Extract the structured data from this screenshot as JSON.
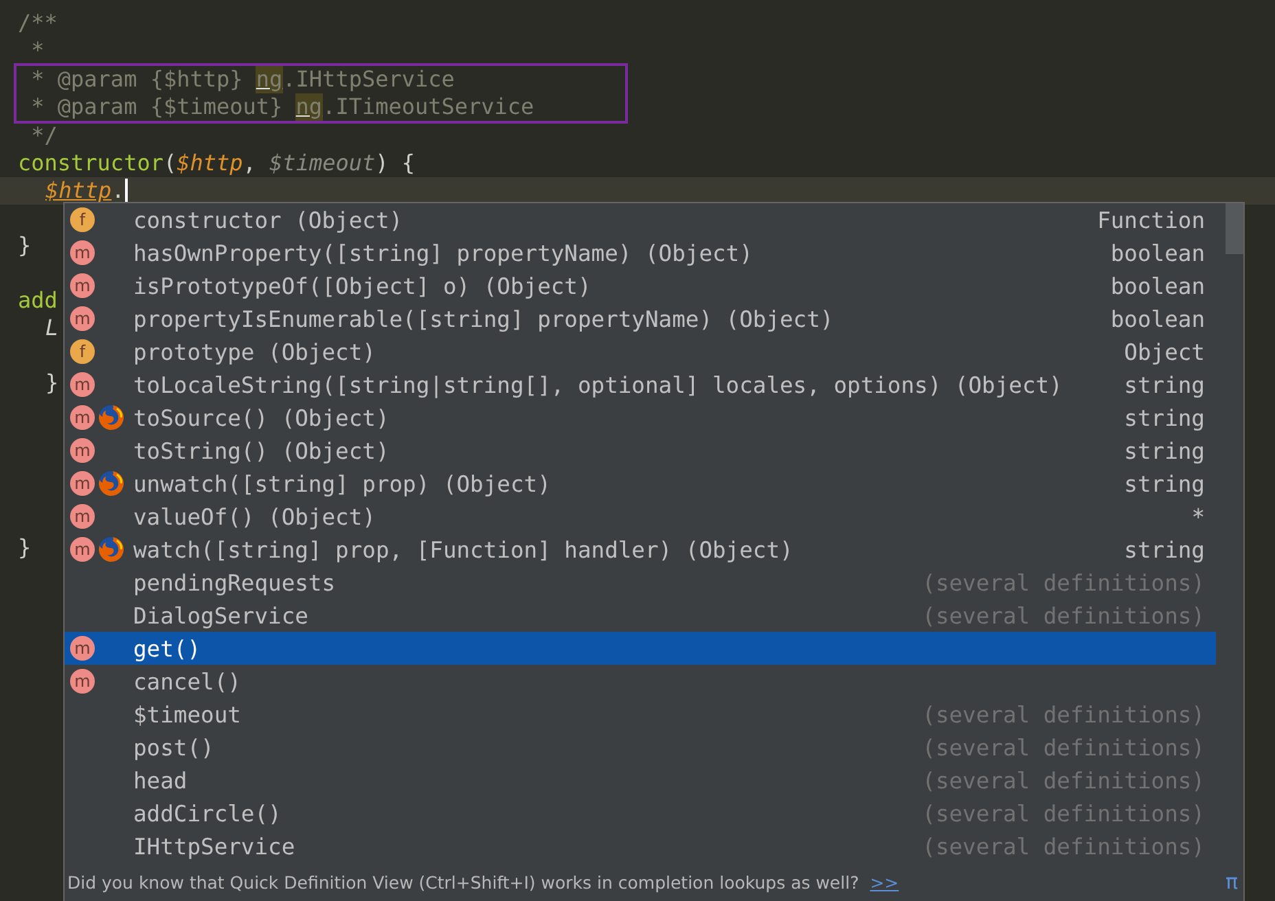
{
  "editor": {
    "lines": [
      {
        "kind": "code",
        "tokens": [
          {
            "text": "/**",
            "kind": "comment"
          }
        ]
      },
      {
        "kind": "code",
        "tokens": [
          {
            "text": " *",
            "kind": "comment"
          }
        ]
      },
      {
        "kind": "code",
        "framed": true,
        "tokens": [
          {
            "text": " * @param {$http} ",
            "kind": "comment"
          },
          {
            "text": "ng",
            "kind": "marked"
          },
          {
            "text": ".IHttpService",
            "kind": "comment"
          }
        ]
      },
      {
        "kind": "code",
        "framed": true,
        "tokens": [
          {
            "text": " * @param {$timeout} ",
            "kind": "comment"
          },
          {
            "text": "ng",
            "kind": "marked"
          },
          {
            "text": ".ITimeoutService",
            "kind": "comment"
          }
        ]
      },
      {
        "kind": "code",
        "tokens": [
          {
            "text": " */",
            "kind": "comment"
          }
        ]
      },
      {
        "kind": "code",
        "tokens": [
          {
            "text": "constructor",
            "kind": "function"
          },
          {
            "text": "(",
            "kind": "plain"
          },
          {
            "text": "$http",
            "kind": "param"
          },
          {
            "text": ", ",
            "kind": "plain"
          },
          {
            "text": "$timeout",
            "kind": "unused"
          },
          {
            "text": ") {",
            "kind": "plain"
          }
        ]
      },
      {
        "kind": "code",
        "indented": true,
        "current": true,
        "tokens": [
          {
            "text": "$http",
            "kind": "param_marked"
          },
          {
            "text": ".",
            "kind": "plain"
          }
        ]
      },
      {
        "kind": "blank"
      },
      {
        "kind": "code",
        "tokens": [
          {
            "text": "}",
            "kind": "plain"
          }
        ]
      },
      {
        "kind": "blank"
      },
      {
        "kind": "code",
        "tokens": [
          {
            "text": "add",
            "kind": "function"
          }
        ]
      },
      {
        "kind": "code",
        "indented": true,
        "tokens": [
          {
            "text": "L",
            "kind": "italic"
          }
        ]
      },
      {
        "kind": "blank"
      },
      {
        "kind": "code",
        "indented": true,
        "tokens": [
          {
            "text": "}",
            "kind": "plain"
          }
        ]
      },
      {
        "kind": "blank"
      },
      {
        "kind": "blank"
      },
      {
        "kind": "blank"
      },
      {
        "kind": "blank"
      },
      {
        "kind": "blank"
      },
      {
        "kind": "code",
        "tokens": [
          {
            "text": "}",
            "kind": "plain"
          }
        ]
      }
    ]
  },
  "completion": {
    "items": [
      {
        "badge": {
          "kind": "field",
          "letter": "f"
        },
        "firefox": false,
        "name": "constructor (Object)",
        "type": "Function",
        "type_dimmed": false,
        "selected": false
      },
      {
        "badge": {
          "kind": "method",
          "letter": "m"
        },
        "firefox": false,
        "name": "hasOwnProperty([string] propertyName) (Object)",
        "type": "boolean",
        "type_dimmed": false,
        "selected": false
      },
      {
        "badge": {
          "kind": "method",
          "letter": "m"
        },
        "firefox": false,
        "name": "isPrototypeOf([Object] o) (Object)",
        "type": "boolean",
        "type_dimmed": false,
        "selected": false
      },
      {
        "badge": {
          "kind": "method",
          "letter": "m"
        },
        "firefox": false,
        "name": "propertyIsEnumerable([string] propertyName) (Object)",
        "type": "boolean",
        "type_dimmed": false,
        "selected": false
      },
      {
        "badge": {
          "kind": "field",
          "letter": "f"
        },
        "firefox": false,
        "name": "prototype (Object)",
        "type": "Object",
        "type_dimmed": false,
        "selected": false
      },
      {
        "badge": {
          "kind": "method",
          "letter": "m"
        },
        "firefox": false,
        "name": "toLocaleString([string|string[], optional] locales, options) (Object)",
        "type": "string",
        "type_dimmed": false,
        "selected": false
      },
      {
        "badge": {
          "kind": "method",
          "letter": "m"
        },
        "firefox": true,
        "name": "toSource() (Object)",
        "type": "string",
        "type_dimmed": false,
        "selected": false
      },
      {
        "badge": {
          "kind": "method",
          "letter": "m"
        },
        "firefox": false,
        "name": "toString() (Object)",
        "type": "string",
        "type_dimmed": false,
        "selected": false
      },
      {
        "badge": {
          "kind": "method",
          "letter": "m"
        },
        "firefox": true,
        "name": "unwatch([string] prop) (Object)",
        "type": "string",
        "type_dimmed": false,
        "selected": false
      },
      {
        "badge": {
          "kind": "method",
          "letter": "m"
        },
        "firefox": false,
        "name": "valueOf() (Object)",
        "type": "*",
        "type_dimmed": false,
        "selected": false
      },
      {
        "badge": {
          "kind": "method",
          "letter": "m"
        },
        "firefox": true,
        "name": "watch([string] prop, [Function] handler) (Object)",
        "type": "string",
        "type_dimmed": false,
        "selected": false
      },
      {
        "firefox": false,
        "name": "pendingRequests",
        "type": "(several definitions)",
        "type_dimmed": true,
        "selected": false
      },
      {
        "firefox": false,
        "name": "DialogService",
        "type": "(several definitions)",
        "type_dimmed": true,
        "selected": false
      },
      {
        "badge": {
          "kind": "method",
          "letter": "m"
        },
        "firefox": false,
        "name": "get()",
        "selected": true
      },
      {
        "badge": {
          "kind": "method",
          "letter": "m"
        },
        "firefox": false,
        "name": "cancel()",
        "selected": false
      },
      {
        "firefox": false,
        "name": "$timeout",
        "type": "(several definitions)",
        "type_dimmed": true,
        "selected": false
      },
      {
        "firefox": false,
        "name": "post()",
        "type": "(several definitions)",
        "type_dimmed": true,
        "selected": false
      },
      {
        "firefox": false,
        "name": "head",
        "type": "(several definitions)",
        "type_dimmed": true,
        "selected": false
      },
      {
        "firefox": false,
        "name": "addCircle()",
        "type": "(several definitions)",
        "type_dimmed": true,
        "selected": false
      },
      {
        "firefox": false,
        "name": "IHttpService",
        "type": "(several definitions)",
        "type_dimmed": true,
        "selected": false
      }
    ],
    "hint": {
      "text": "Did you know that Quick Definition View (Ctrl+Shift+I) works in completion lookups as well?",
      "link": ">>",
      "corner": "π"
    }
  }
}
